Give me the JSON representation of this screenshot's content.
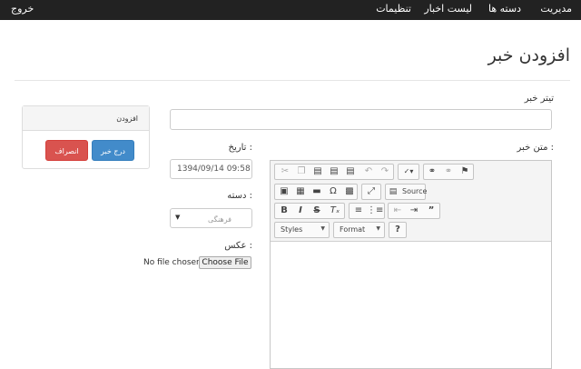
{
  "navbar": {
    "items": [
      "مدیریت",
      "دسته ها",
      "لیست اخبار",
      "تنظیمات"
    ],
    "logout": "خروج"
  },
  "page": {
    "title": "افزودن خبر"
  },
  "form": {
    "news_title_label": "تیتر خبر",
    "news_text_label": "متن خبر :",
    "date_label": "تاریخ :",
    "date_value": "1394/09/14  09:58",
    "category_label": "دسته :",
    "category_value": "فرهنگی",
    "image_label": "عکس :",
    "file_status": "No file chosen",
    "file_button": "Choose File"
  },
  "panel": {
    "title": "افزودن",
    "submit_label": "درج خبر",
    "cancel_label": "انصراف"
  },
  "editor": {
    "toolbar": {
      "row1": [
        "cut-icon",
        "copy-icon",
        "paste-icon",
        "paste-text-icon",
        "paste-word-icon",
        "undo-icon",
        "redo-icon",
        "spellcheck-icon",
        "link-icon",
        "unlink-icon",
        "anchor-icon"
      ],
      "row2": [
        "image-icon",
        "table-icon",
        "horizontal-rule-icon",
        "special-char-icon",
        "iframe-icon",
        "maximize-icon",
        "source-icon"
      ],
      "source_label": "Source",
      "row3": [
        "bold-icon",
        "italic-icon",
        "strike-icon",
        "remove-format-icon",
        "numbered-list-icon",
        "bulleted-list-icon",
        "outdent-icon",
        "indent-icon",
        "blockquote-icon"
      ],
      "styles_label": "Styles",
      "format_label": "Format",
      "help_label": "?"
    }
  }
}
